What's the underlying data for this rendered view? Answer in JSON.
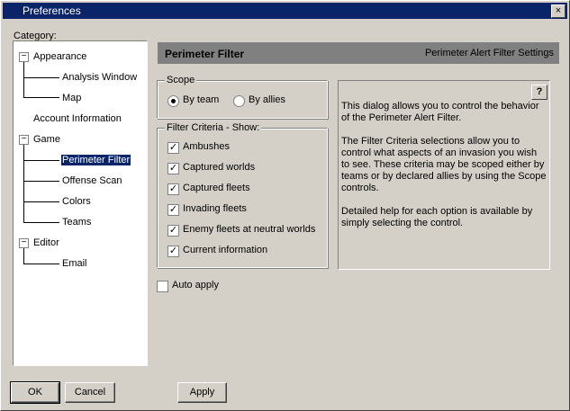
{
  "window": {
    "title": "Preferences",
    "close_label": "×"
  },
  "category": {
    "label": "Category:",
    "tree": [
      {
        "label": "Appearance",
        "expander": "−"
      },
      {
        "label": "Analysis Window"
      },
      {
        "label": "Map"
      },
      {
        "label": "Account Information"
      },
      {
        "label": "Game",
        "expander": "−"
      },
      {
        "label": "Perimeter Filter",
        "selected": true
      },
      {
        "label": "Offense Scan"
      },
      {
        "label": "Colors"
      },
      {
        "label": "Teams"
      },
      {
        "label": "Editor",
        "expander": "−"
      },
      {
        "label": "Email"
      }
    ]
  },
  "panel": {
    "title": "Perimeter Filter",
    "subtitle": "Perimeter Alert Filter Settings"
  },
  "scope": {
    "legend": "Scope",
    "options": [
      {
        "label": "By team",
        "checked": true
      },
      {
        "label": "By allies",
        "checked": false
      }
    ]
  },
  "filter": {
    "legend": "Filter Criteria - Show:",
    "items": [
      {
        "label": "Ambushes",
        "checked": true
      },
      {
        "label": "Captured worlds",
        "checked": true
      },
      {
        "label": "Captured fleets",
        "checked": true
      },
      {
        "label": "Invading fleets",
        "checked": true
      },
      {
        "label": "Enemy fleets at neutral worlds",
        "checked": true
      },
      {
        "label": "Current information",
        "checked": true
      }
    ]
  },
  "help": {
    "button": "?",
    "text": "This dialog allows you to control the behavior of the Perimeter Alert Filter.\n\nThe Filter Criteria selections allow you to control what aspects of an invasion you wish to see. These criteria may be scoped either by teams or by declared allies by using the Scope controls.\n\nDetailed help for each option is available by simply selecting the control."
  },
  "auto_apply": {
    "label": "Auto apply",
    "checked": false
  },
  "buttons": {
    "ok": "OK",
    "cancel": "Cancel",
    "apply": "Apply"
  }
}
